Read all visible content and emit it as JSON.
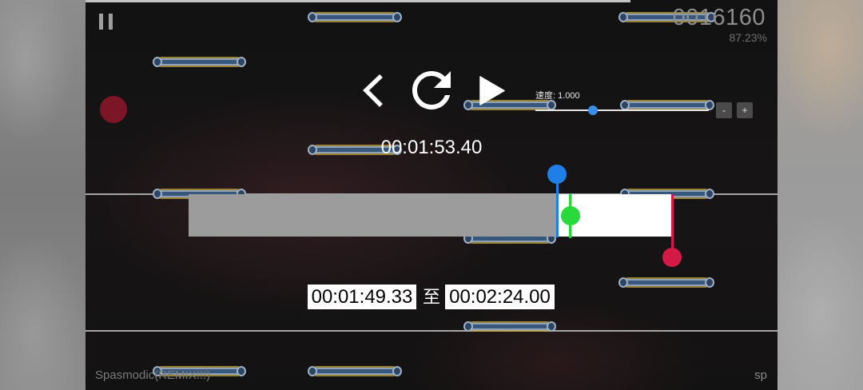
{
  "hud": {
    "score": "0016160",
    "accuracy": "87.23%",
    "song_progress": 0.787,
    "song_title": "Spasmodic(REMIX!!!)",
    "difficulty": "sp"
  },
  "icons": {
    "pause": "pause-icon",
    "back": "chevron-left-icon",
    "restart": "restart-icon",
    "play": "play-icon"
  },
  "speed": {
    "label": "速度: 1.000",
    "slider_fraction": 0.33,
    "decrease_label": "-",
    "increase_label": "+"
  },
  "playback": {
    "current_time": "00:01:53.40"
  },
  "range": {
    "start_time": "00:01:49.33",
    "separator": "至",
    "end_time": "00:02:24.00",
    "start_progress": 0.762,
    "current_progress": 0.79,
    "end_progress": 1.0
  },
  "colors": {
    "start_marker": "#1f7fe6",
    "current_marker": "#27d93b",
    "end_marker": "#d31a47",
    "slider_thumb": "#3a8ee6",
    "range_selected": "#ffffff",
    "range_unselected": "#9c9c9c",
    "hit_circle": "#7c1626"
  }
}
